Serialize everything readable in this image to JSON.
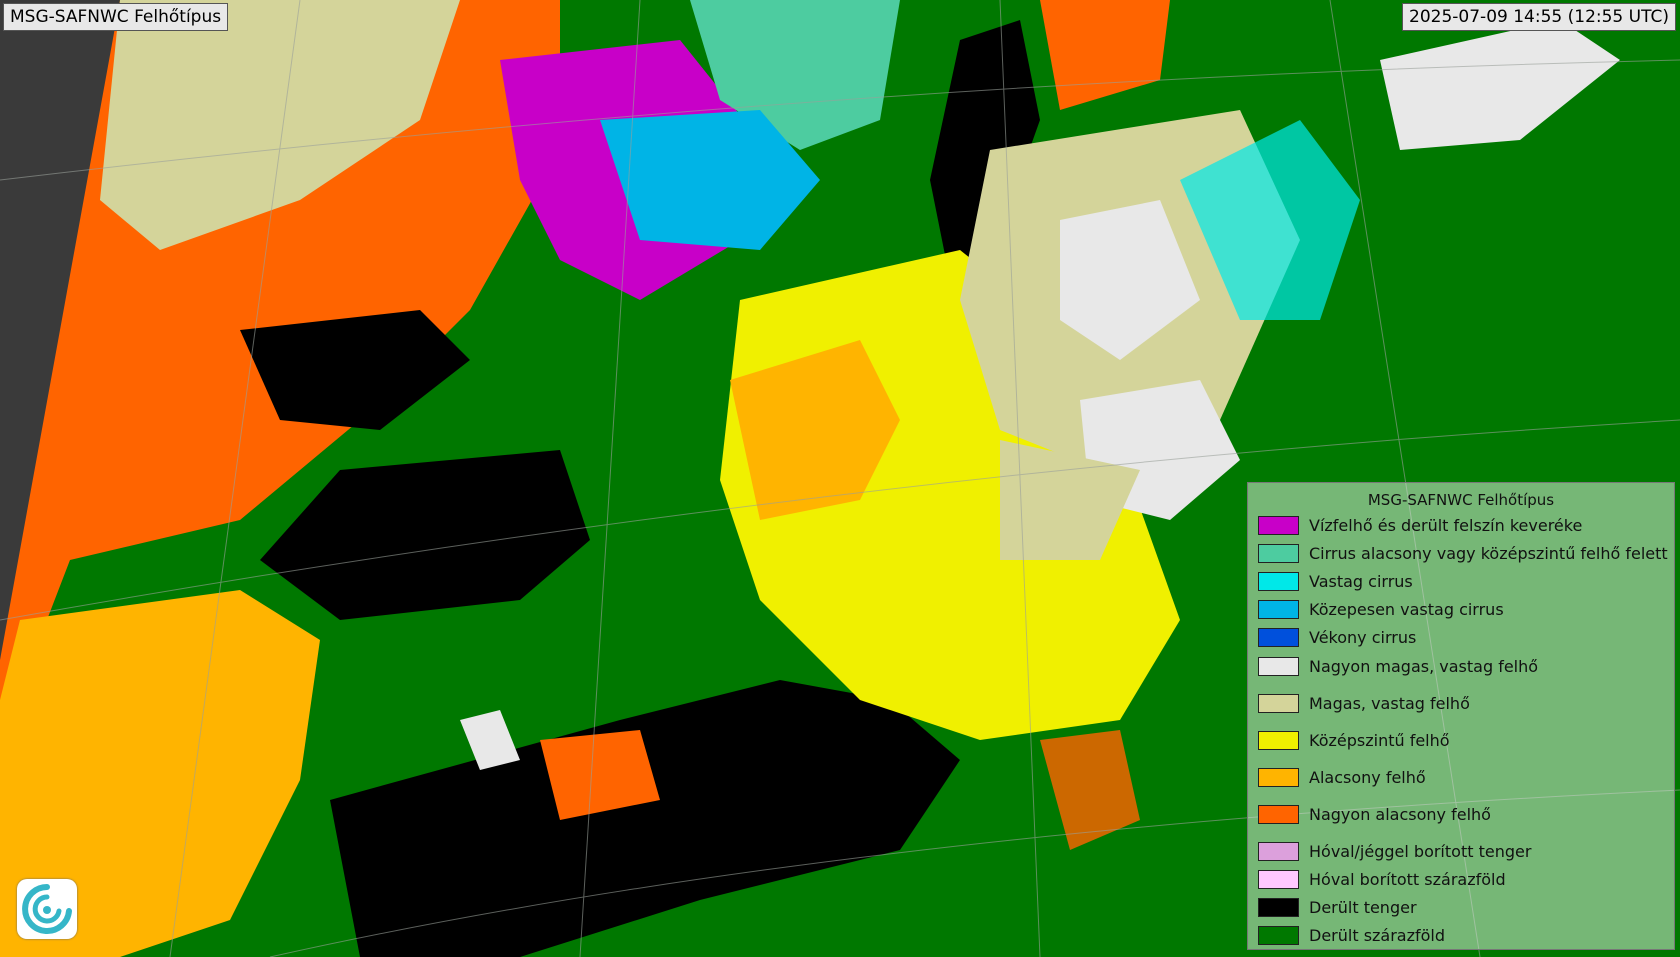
{
  "header": {
    "title": "MSG-SAFNWC Felhőtípus",
    "timestamp": "2025-07-09 14:55 (12:55 UTC)"
  },
  "legend": {
    "title": "MSG-SAFNWC Felhőtípus",
    "items": [
      {
        "label": "Vízfelhő és derült felszín keveréke",
        "color": "#c800c8"
      },
      {
        "label": "Cirrus alacsony vagy középszintű felhő felett",
        "color": "#4dcca0"
      },
      {
        "label": "Vastag cirrus",
        "color": "#00e8e8"
      },
      {
        "label": "Közepesen vastag cirrus",
        "color": "#00b4e6"
      },
      {
        "label": "Vékony cirrus",
        "color": "#0050dc"
      },
      {
        "label": "Nagyon magas, vastag felhő",
        "color": "#e8e8e8"
      },
      {
        "label": "Magas, vastag felhő",
        "color": "#d4d49a"
      },
      {
        "label": "Középszintű felhő",
        "color": "#f0f000"
      },
      {
        "label": "Alacsony felhő",
        "color": "#ffb400"
      },
      {
        "label": "Nagyon alacsony felhő",
        "color": "#ff6400"
      },
      {
        "label": "Hóval/jéggel borított tenger",
        "color": "#dca0dc"
      },
      {
        "label": "Hóval borított szárazföld",
        "color": "#ffc8ff"
      },
      {
        "label": "Derült tenger",
        "color": "#000000"
      },
      {
        "label": "Derült szárazföld",
        "color": "#007800"
      }
    ]
  },
  "logo": {
    "icon": "cloud-swirl-logo-icon"
  }
}
